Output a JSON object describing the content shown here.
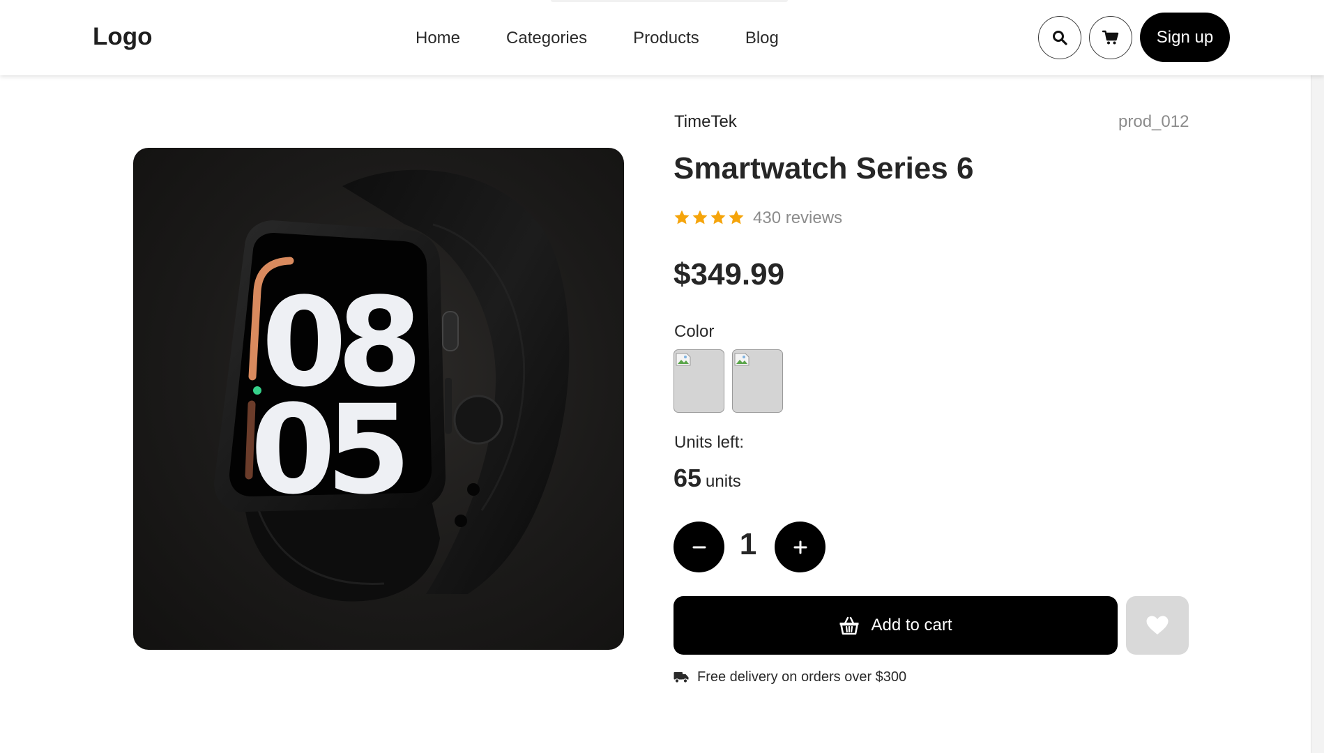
{
  "header": {
    "logo": "Logo",
    "nav": [
      "Home",
      "Categories",
      "Products",
      "Blog"
    ],
    "signup_label": "Sign up"
  },
  "product": {
    "brand": "TimeTek",
    "sku": "prod_012",
    "title": "Smartwatch Series 6",
    "rating": 4,
    "rating_max": 4,
    "reviews": "430 reviews",
    "price": "$349.99",
    "color_label": "Color",
    "units_label": "Units left:",
    "units_count": "65",
    "units_word": "units",
    "quantity": "1",
    "add_to_cart_label": "Add to cart",
    "delivery_note": "Free delivery on orders over $300",
    "image": {
      "watch_hour": "08",
      "watch_minute": "05"
    }
  },
  "colors": {
    "primary": "#000000",
    "star": "#f5a40a",
    "muted_text": "#8c8c8c",
    "wishlist_bg": "#d9d9d9"
  },
  "icons": {
    "search": "search-icon",
    "cart": "cart-icon",
    "basket": "basket-icon",
    "heart": "heart-icon",
    "truck": "truck-icon",
    "minus": "minus-icon",
    "plus": "plus-icon"
  }
}
